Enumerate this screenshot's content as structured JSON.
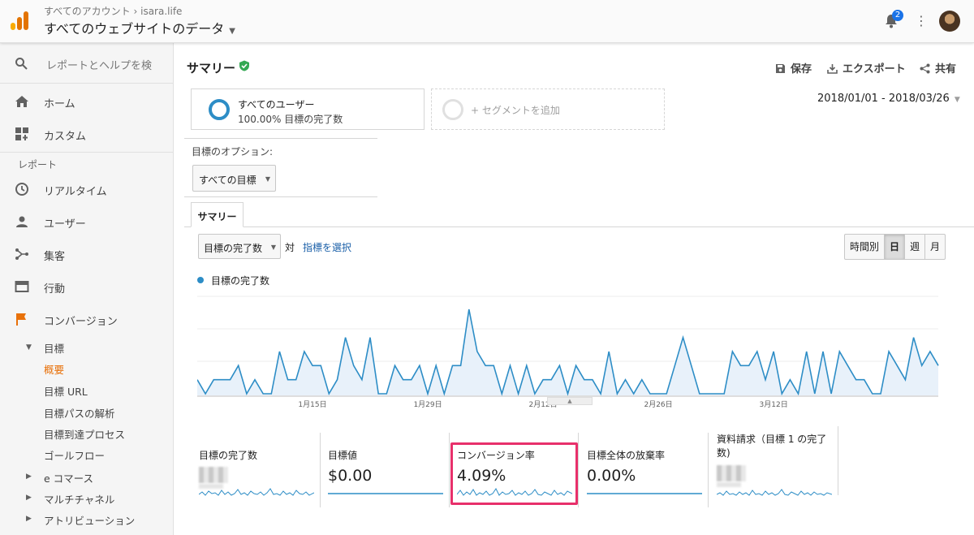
{
  "header": {
    "breadcrumb": "すべてのアカウント › isara.life",
    "property": "すべてのウェブサイトのデータ",
    "notification_count": "2",
    "icons": [
      "analytics-logo-icon",
      "bell-icon",
      "more-vert-icon",
      "avatar"
    ]
  },
  "sidebar": {
    "search_placeholder": "レポートとヘルプを検索",
    "items": [
      {
        "label": "ホーム",
        "icon": "home-icon"
      },
      {
        "label": "カスタム",
        "icon": "dashboard-add-icon"
      }
    ],
    "reports_label": "レポート",
    "report_items": [
      {
        "label": "リアルタイム",
        "icon": "clock-icon"
      },
      {
        "label": "ユーザー",
        "icon": "person-icon"
      },
      {
        "label": "集客",
        "icon": "acquisition-icon"
      },
      {
        "label": "行動",
        "icon": "behavior-icon"
      },
      {
        "label": "コンバージョン",
        "icon": "flag-icon",
        "color": "#e8710a"
      }
    ],
    "goals": {
      "label": "目標",
      "subitems": [
        "概要",
        "目標 URL",
        "目標パスの解析",
        "目標到達プロセス",
        "ゴールフロー"
      ]
    },
    "collapsed": [
      "e コマース",
      "マルチチャネル",
      "アトリビューション"
    ]
  },
  "main": {
    "title": "サマリー",
    "actions": {
      "save": "保存",
      "export": "エクスポート",
      "share": "共有"
    },
    "segment": {
      "name": "すべてのユーザー",
      "detail": "100.00% 目標の完了数",
      "add": "+ セグメントを追加"
    },
    "date_range": "2018/01/01 - 2018/03/26",
    "goal_option_label": "目標のオプション:",
    "goal_option_value": "すべての目標",
    "tab": "サマリー",
    "metric_select": "目標の完了数",
    "vs_label": "対",
    "pick_metric": "指標を選択",
    "granularity": [
      "時間別",
      "日",
      "週",
      "月"
    ],
    "granularity_selected": "日",
    "legend": "目標の完了数"
  },
  "chart_data": {
    "type": "line",
    "series": [
      {
        "name": "目標の完了数",
        "values": [
          1,
          0,
          1,
          1,
          1,
          2,
          0,
          1,
          0,
          0,
          3,
          1,
          1,
          3,
          2,
          2,
          0,
          1,
          4,
          2,
          1,
          4,
          0,
          0,
          2,
          1,
          1,
          2,
          0,
          2,
          0,
          2,
          2,
          6,
          3,
          2,
          2,
          0,
          2,
          0,
          2,
          0,
          1,
          1,
          2,
          0,
          2,
          1,
          1,
          0,
          3,
          0,
          1,
          0,
          1,
          0,
          0,
          0,
          2,
          4,
          2,
          0,
          0,
          0,
          0,
          3,
          2,
          2,
          3,
          1,
          3,
          0,
          1,
          0,
          3,
          0,
          3,
          0,
          3,
          2,
          1,
          1,
          0,
          0,
          3,
          2,
          1,
          4,
          2,
          3,
          2
        ]
      }
    ],
    "x_tick_labels": [
      "1月15日",
      "1月29日",
      "2月12日",
      "2月26日",
      "3月12日"
    ],
    "ylim": [
      0,
      6
    ],
    "color": "#2d8dc6"
  },
  "scorecards": [
    {
      "name": "目標の完了数",
      "value": null,
      "blurred": true
    },
    {
      "name": "目標値",
      "value": "$0.00"
    },
    {
      "name": "コンバージョン率",
      "value": "4.09%",
      "highlighted": true
    },
    {
      "name": "目標全体の放棄率",
      "value": "0.00%"
    },
    {
      "name": "資料請求（目標 1 の完了数)",
      "value": null,
      "blurred": true
    }
  ],
  "colors": {
    "accent": "#2d8dc6",
    "highlight": "#e8306b",
    "orange": "#e8710a",
    "link": "#1a5fa8"
  }
}
